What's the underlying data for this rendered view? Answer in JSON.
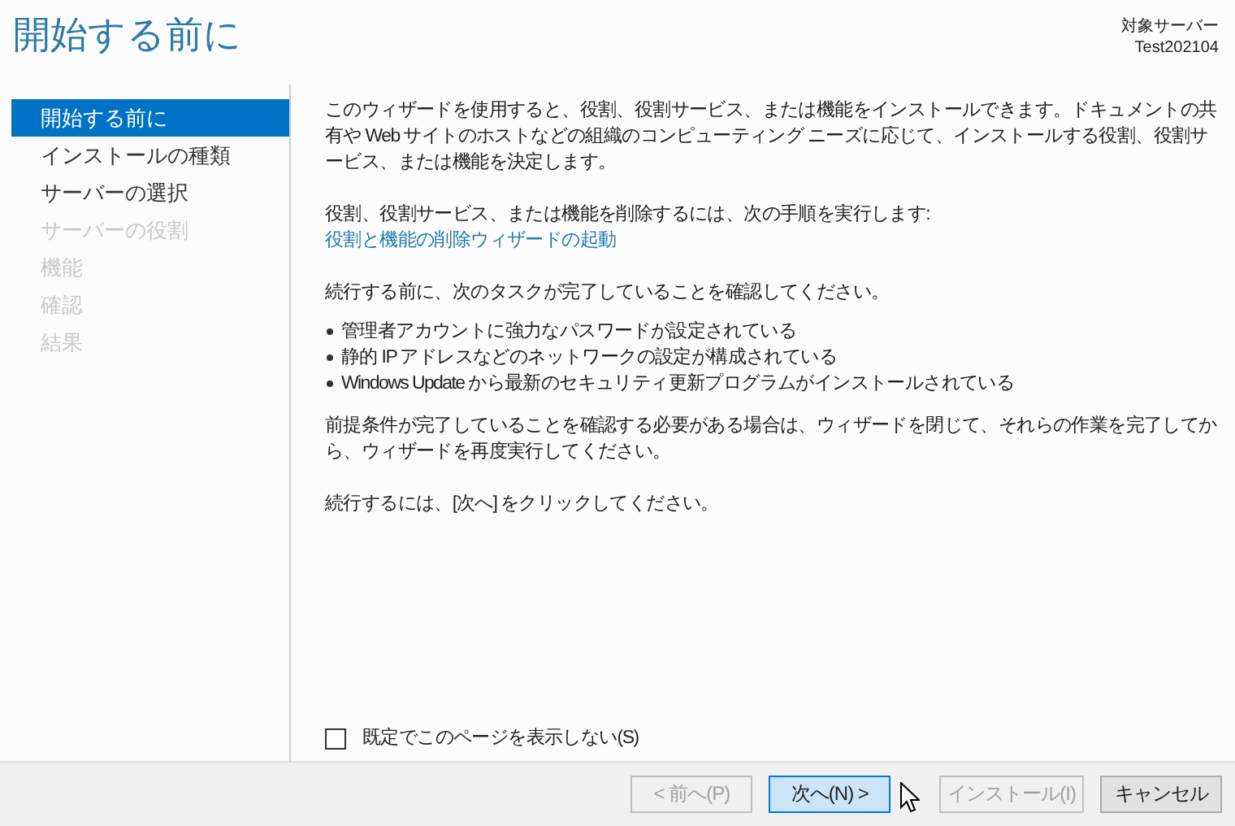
{
  "window": {
    "title": "開始する前に"
  },
  "target_server": {
    "label": "対象サーバー",
    "name": "Test202104"
  },
  "steps": [
    {
      "label": "開始する前に",
      "selected": true,
      "disabled": false
    },
    {
      "label": "インストールの種類",
      "selected": false,
      "disabled": false
    },
    {
      "label": "サーバーの選択",
      "selected": false,
      "disabled": false
    },
    {
      "label": "サーバーの役割",
      "selected": false,
      "disabled": true
    },
    {
      "label": "機能",
      "selected": false,
      "disabled": true
    },
    {
      "label": "確認",
      "selected": false,
      "disabled": true
    },
    {
      "label": "結果",
      "selected": false,
      "disabled": true
    }
  ],
  "content": {
    "intro": "このウィザードを使用すると、役割、役割サービス、または機能をインストールできます。ドキュメントの共有や Web サイトのホストなどの組織のコンピューティング ニーズに応じて、インストールする役割、役割サービス、または機能を決定します。",
    "remove_text": "役割、役割サービス、または機能を削除するには、次の手順を実行します:",
    "remove_link": "役割と機能の削除ウィザードの起動",
    "confirm_text": "続行する前に、次のタスクが完了していることを確認してください。",
    "bullets": [
      "管理者アカウントに強力なパスワードが設定されている",
      "静的 IP アドレスなどのネットワークの設定が構成されている",
      "Windows Update から最新のセキュリティ更新プログラムがインストールされている"
    ],
    "prereq_text": "前提条件が完了していることを確認する必要がある場合は、ウィザードを閉じて、それらの作業を完了してから、ウィザードを再度実行してください。",
    "continue_text": "続行するには、[次へ] をクリックしてください。"
  },
  "checkbox": {
    "label": "既定でこのページを表示しない(S)",
    "checked": false
  },
  "buttons": [
    {
      "label": "< 前へ(P)",
      "disabled": true,
      "highlighted": false
    },
    {
      "label": "次へ(N) >",
      "disabled": false,
      "highlighted": true
    },
    {
      "label": "インストール(I)",
      "disabled": true,
      "highlighted": false
    },
    {
      "label": "キャンセル",
      "disabled": false,
      "highlighted": false
    }
  ]
}
